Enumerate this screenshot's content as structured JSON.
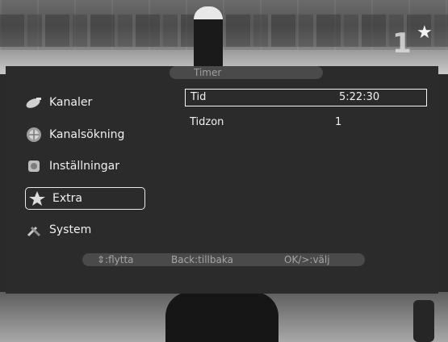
{
  "menu": {
    "title": "Timer",
    "items": [
      {
        "label": "Kanaler",
        "icon": "satellite-dish-icon",
        "selected": false
      },
      {
        "label": "Kanalsökning",
        "icon": "globe-search-icon",
        "selected": false
      },
      {
        "label": "Inställningar",
        "icon": "settings-tools-icon",
        "selected": false
      },
      {
        "label": "Extra",
        "icon": "extra-star-icon",
        "selected": true
      },
      {
        "label": "System",
        "icon": "wrench-screwdriver-icon",
        "selected": false
      }
    ]
  },
  "settings": {
    "rows": [
      {
        "label": "Tid",
        "value": "5:22:30",
        "selected": true
      },
      {
        "label": "Tidzon",
        "value": "1",
        "selected": false
      }
    ]
  },
  "statusbar": {
    "move": "⇕:flytta",
    "back": "Back:tillbaka",
    "ok": "OK/>:välj"
  },
  "background": {
    "score": "1",
    "star": "★"
  },
  "colors": {
    "panel": "#2b2b2b",
    "bar": "#4a4a4a",
    "text": "#f0f0f0",
    "muted": "#9e9e9e"
  }
}
